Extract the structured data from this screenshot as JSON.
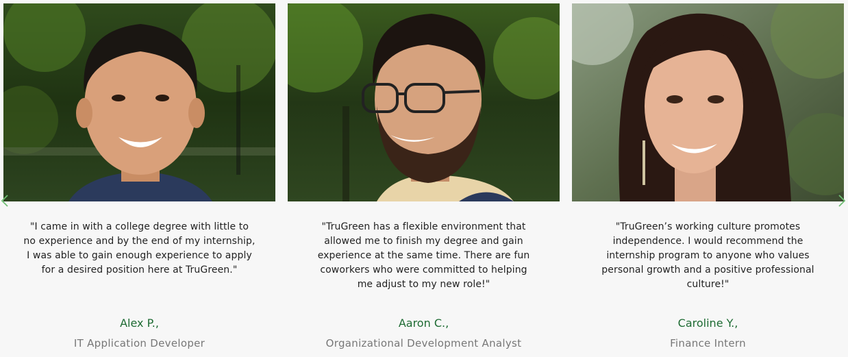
{
  "carousel": {
    "prev_icon": "chevron-left-icon",
    "next_icon": "chevron-right-icon",
    "accent_color": "#1e6b33",
    "testimonials": [
      {
        "photo_alt": "Alex P.",
        "quote": "\"I came in with a college degree with little to no experience and by the end of my internship, I was able to gain enough experience to apply for a desired position here at TruGreen.\"",
        "name": "Alex P.,",
        "role": "IT Application Developer"
      },
      {
        "photo_alt": "Aaron C.",
        "quote": "\"TruGreen has a flexible environment that allowed me to finish my degree and gain experience at the same time. There are fun coworkers who were committed to helping me adjust to my new role!\"",
        "name": "Aaron C.,",
        "role": "Organizational Development Analyst"
      },
      {
        "photo_alt": "Caroline Y.",
        "quote": "\"TruGreen’s working culture promotes independence. I would recommend the internship program to anyone who values personal growth and a positive professional culture!\"",
        "name": "Caroline Y.,",
        "role": "Finance Intern"
      }
    ]
  }
}
